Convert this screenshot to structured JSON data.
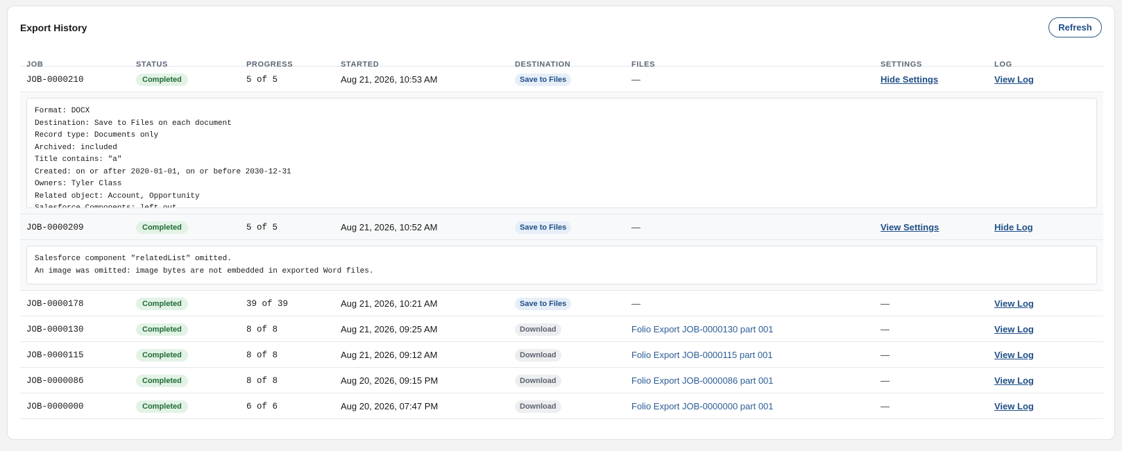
{
  "title": "Export History",
  "refresh_label": "Refresh",
  "columns": [
    "Job",
    "Status",
    "Progress",
    "Started",
    "Destination",
    "Files",
    "Settings",
    "Log"
  ],
  "rows": [
    {
      "job": "JOB-0000210",
      "status": "Completed",
      "progress": "5 of 5",
      "started": "Aug 21, 2026, 10:53 AM",
      "destination": "Save to Files",
      "files": "—",
      "settings": "Hide Settings",
      "log": "View Log"
    },
    {
      "job": "JOB-0000209",
      "status": "Completed",
      "progress": "5 of 5",
      "started": "Aug 21, 2026, 10:52 AM",
      "destination": "Save to Files",
      "files": "—",
      "settings": "View Settings",
      "log": "Hide Log"
    },
    {
      "job": "JOB-0000178",
      "status": "Completed",
      "progress": "39 of 39",
      "started": "Aug 21, 2026, 10:21 AM",
      "destination": "Save to Files",
      "files": "—",
      "settings": "—",
      "log": "View Log"
    },
    {
      "job": "JOB-0000130",
      "status": "Completed",
      "progress": "8 of 8",
      "started": "Aug 21, 2026, 09:25 AM",
      "destination": "Download",
      "files": "Folio Export JOB-0000130 part 001",
      "settings": "—",
      "log": "View Log"
    },
    {
      "job": "JOB-0000115",
      "status": "Completed",
      "progress": "8 of 8",
      "started": "Aug 21, 2026, 09:12 AM",
      "destination": "Download",
      "files": "Folio Export JOB-0000115 part 001",
      "settings": "—",
      "log": "View Log"
    },
    {
      "job": "JOB-0000086",
      "status": "Completed",
      "progress": "8 of 8",
      "started": "Aug 20, 2026, 09:15 PM",
      "destination": "Download",
      "files": "Folio Export JOB-0000086 part 001",
      "settings": "—",
      "log": "View Log"
    },
    {
      "job": "JOB-0000000",
      "status": "Completed",
      "progress": "6 of 6",
      "started": "Aug 20, 2026, 07:47 PM",
      "destination": "Download",
      "files": "Folio Export JOB-0000000 part 001",
      "settings": "—",
      "log": "View Log"
    }
  ],
  "settings_detail": [
    "Format: DOCX",
    "Destination: Save to Files on each document",
    "Record type: Documents only",
    "Archived: included",
    "Title contains: \"a\"",
    "Created: on or after 2020-01-01, on or before 2030-12-31",
    "Owners: Tyler Class",
    "Related object: Account, Opportunity",
    "Salesforce Components: left out"
  ],
  "log_detail": [
    "Salesforce component \"relatedList\" omitted.",
    "An image was omitted: image bytes are not embedded in exported Word files."
  ]
}
